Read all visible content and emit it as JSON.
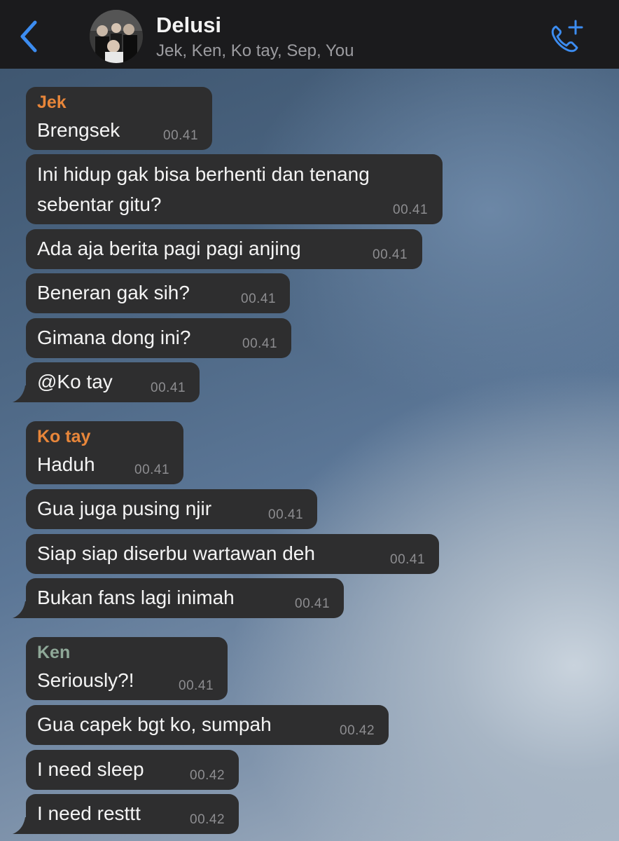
{
  "header": {
    "title": "Delusi",
    "members": "Jek, Ken, Ko tay, Sep, You",
    "accent": "#3c8cf0"
  },
  "icons": {
    "back": "chevron-left-icon",
    "call": "phone-plus-icon",
    "avatar": "group-avatar"
  },
  "colors": {
    "bubble": "#2e2e2f",
    "jek": "#e8863a",
    "kotay": "#e8863a",
    "ken": "#8fa898",
    "time": "#8d8d90"
  },
  "groups": [
    {
      "sender": "Jek",
      "messages": [
        {
          "text": "Brengsek",
          "time": "00.41"
        },
        {
          "text": "Ini hidup gak bisa berhenti dan tenang\nsebentar gitu?",
          "time": "00.41"
        },
        {
          "text": "Ada aja berita pagi pagi anjing",
          "time": "00.41"
        },
        {
          "text": "Beneran gak sih?",
          "time": "00.41"
        },
        {
          "text": "Gimana dong ini?",
          "time": "00.41"
        },
        {
          "text": "@Ko tay",
          "time": "00.41"
        }
      ]
    },
    {
      "sender": "Ko tay",
      "messages": [
        {
          "text": "Haduh",
          "time": "00.41"
        },
        {
          "text": "Gua juga pusing njir",
          "time": "00.41"
        },
        {
          "text": "Siap siap diserbu wartawan deh",
          "time": "00.41"
        },
        {
          "text": "Bukan fans lagi inimah",
          "time": "00.41"
        }
      ]
    },
    {
      "sender": "Ken",
      "messages": [
        {
          "text": "Seriously?!",
          "time": "00.41"
        },
        {
          "text": "Gua capek bgt ko, sumpah",
          "time": "00.42"
        },
        {
          "text": "I need sleep",
          "time": "00.42"
        },
        {
          "text": "I need resttt",
          "time": "00.42"
        }
      ]
    }
  ]
}
